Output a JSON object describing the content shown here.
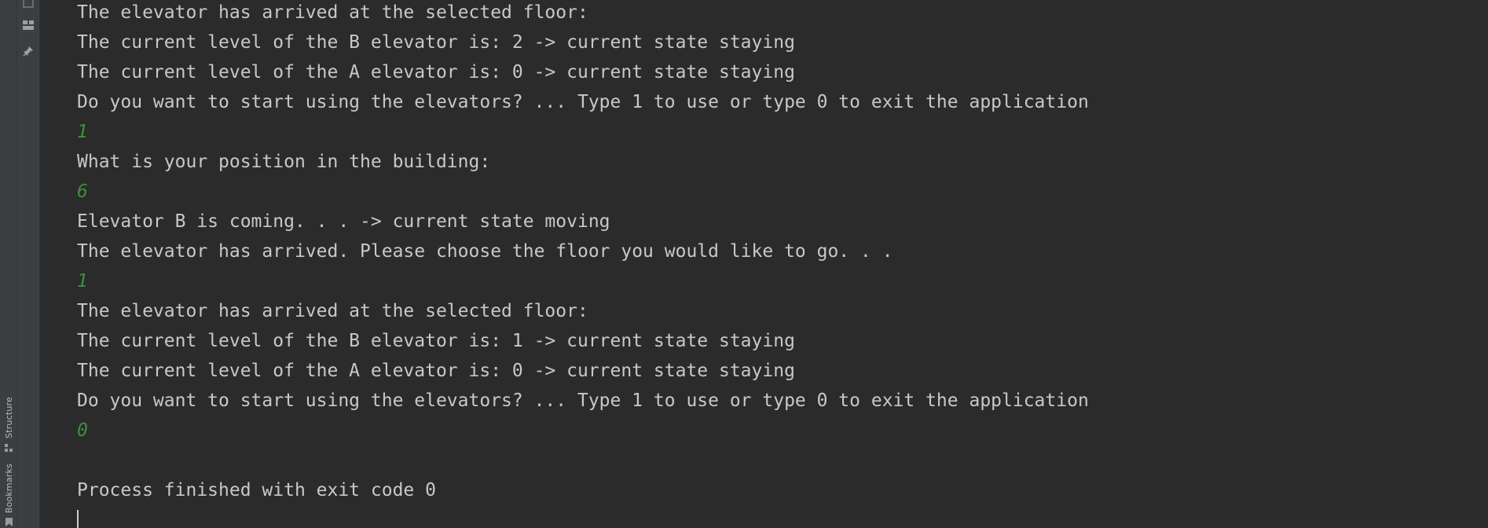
{
  "sidebar": {
    "tabs": [
      {
        "label": "Structure",
        "icon": "structure-icon"
      },
      {
        "label": "Bookmarks",
        "icon": "bookmark-icon"
      }
    ]
  },
  "toolbar": {
    "icons": [
      "export-icon",
      "layout-icon",
      "pin-icon"
    ]
  },
  "console": {
    "lines": [
      {
        "kind": "output",
        "text": "The elevator has arrived at the selected floor:"
      },
      {
        "kind": "output",
        "text": "The current level of the B elevator is: 2 -> current state staying"
      },
      {
        "kind": "output",
        "text": "The current level of the A elevator is: 0 -> current state staying"
      },
      {
        "kind": "output",
        "text": "Do you want to start using the elevators? ... Type 1 to use or type 0 to exit the application"
      },
      {
        "kind": "input",
        "text": "1"
      },
      {
        "kind": "output",
        "text": "What is your position in the building:"
      },
      {
        "kind": "input",
        "text": "6"
      },
      {
        "kind": "output",
        "text": "Elevator B is coming. . . -> current state moving"
      },
      {
        "kind": "output",
        "text": "The elevator has arrived. Please choose the floor you would like to go. . ."
      },
      {
        "kind": "input",
        "text": "1"
      },
      {
        "kind": "output",
        "text": "The elevator has arrived at the selected floor:"
      },
      {
        "kind": "output",
        "text": "The current level of the B elevator is: 1 -> current state staying"
      },
      {
        "kind": "output",
        "text": "The current level of the A elevator is: 0 -> current state staying"
      },
      {
        "kind": "output",
        "text": "Do you want to start using the elevators? ... Type 1 to use or type 0 to exit the application"
      },
      {
        "kind": "input",
        "text": "0"
      },
      {
        "kind": "output",
        "text": ""
      },
      {
        "kind": "output",
        "text": "Process finished with exit code 0"
      }
    ]
  },
  "colors": {
    "background": "#2b2b2b",
    "output_text": "#c8c8c8",
    "input_text": "#3e8f3e",
    "side_panel": "#3c3f41"
  }
}
